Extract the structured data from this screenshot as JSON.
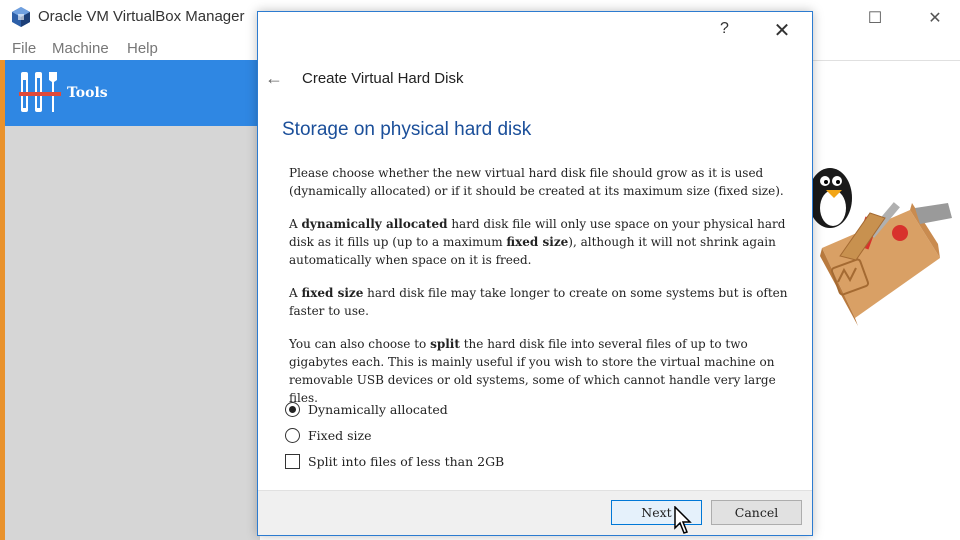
{
  "main_window": {
    "title": "Oracle VM VirtualBox Manager",
    "controls": {
      "minimize": "—",
      "maximize": "☐",
      "close": "✕"
    },
    "menu": [
      "File",
      "Machine",
      "Help"
    ],
    "tools_label": "Tools"
  },
  "dialog": {
    "help": "?",
    "close": "✕",
    "back": "←",
    "heading": "Create Virtual Hard Disk",
    "section_title": "Storage on physical hard disk",
    "para1": "Please choose whether the new virtual hard disk file should grow as it is used (dynamically allocated) or if it should be created at its maximum size (fixed size).",
    "para2": {
      "t1": "A ",
      "b1": "dynamically allocated",
      "t2": " hard disk file will only use space on your physical hard disk as it fills up (up to a maximum ",
      "b2": "fixed size",
      "t3": "), although it will not shrink again automatically when space on it is freed."
    },
    "para3": {
      "t1": "A ",
      "b1": "fixed size",
      "t2": " hard disk file may take longer to create on some systems but is often faster to use."
    },
    "para4": {
      "t1": "You can also choose to ",
      "b1": "split",
      "t2": " the hard disk file into several files of up to two gigabytes each. This is mainly useful if you wish to store the virtual machine on removable USB devices or old systems, some of which cannot handle very large files."
    },
    "options": {
      "dynamic": "Dynamically allocated",
      "fixed": "Fixed size",
      "split": "Split into files of less than 2GB"
    },
    "selected_option": "dynamic",
    "split_checked": false,
    "buttons": {
      "next": "Next",
      "cancel": "Cancel"
    }
  },
  "colors": {
    "accent": "#2f87e3",
    "section_title": "#1b4f9a",
    "dialog_border": "#2c7bd0",
    "left_edge": "#e9922c"
  }
}
